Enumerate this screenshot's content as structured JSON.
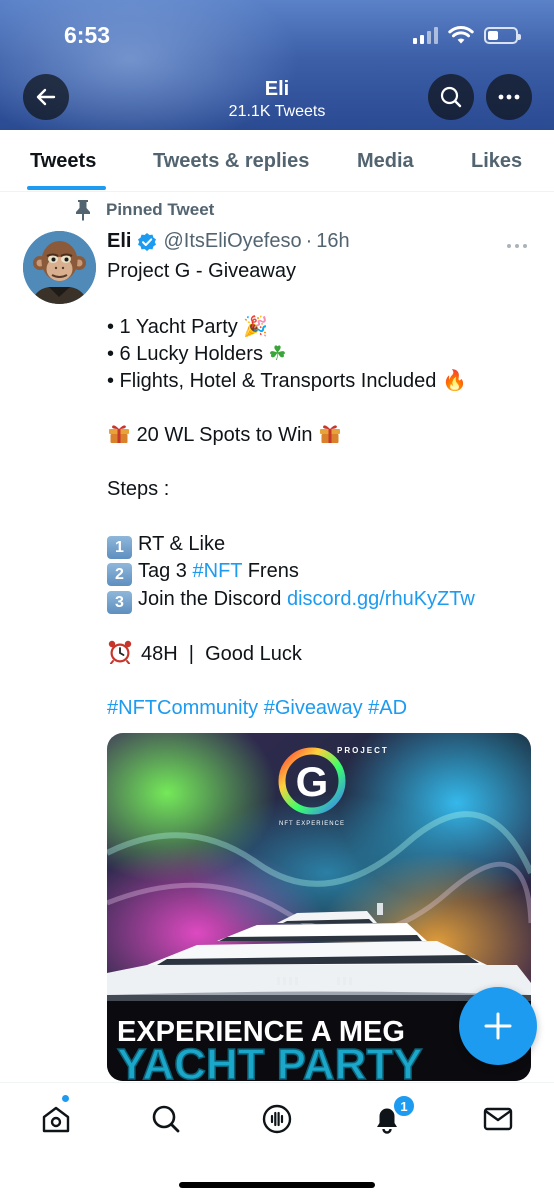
{
  "status_bar": {
    "time": "6:53"
  },
  "profile": {
    "name": "Eli",
    "tweet_count": "21.1K Tweets"
  },
  "tabs": [
    {
      "label": "Tweets",
      "active": true
    },
    {
      "label": "Tweets & replies",
      "active": false
    },
    {
      "label": "Media",
      "active": false
    },
    {
      "label": "Likes",
      "active": false
    }
  ],
  "pinned_label": "Pinned Tweet",
  "tweet": {
    "author": "Eli",
    "handle": "@ItsEliOyefeso",
    "separator": "·",
    "time": "16h",
    "line_title": "Project G - Giveaway",
    "bullet1": "• 1 Yacht Party",
    "bullet2": "• 6 Lucky Holders",
    "bullet3": "• Flights, Hotel & Transports Included",
    "spots": "20 WL Spots to Win",
    "steps": "Steps :",
    "step1": "RT & Like",
    "step2_pre": "Tag 3",
    "step2_tag": "#NFT",
    "step2_post": "Frens",
    "step3_pre": "Join the Discord",
    "step3_link": "discord.gg/rhuKyZTw",
    "deadline": "48H  |  Good Luck",
    "hashtags": "#NFTCommunity #Giveaway #AD",
    "emoji_party": "🎉",
    "emoji_clover": "☘",
    "emoji_fire": "🔥",
    "key1": "1",
    "key2": "2",
    "key3": "3"
  },
  "media": {
    "logo_letter": "G",
    "logo_ring_text": "PROJECT",
    "logo_sub": "NFT EXPERIENCE",
    "headline1": "EXPERIENCE A MEG",
    "headline2": "YACHT PARTY"
  },
  "bottom_nav": {
    "notification_count": "1"
  },
  "colors": {
    "accent": "#1d9bf0",
    "header_top": "#5b82c8",
    "header_bottom": "#2a4a92"
  }
}
